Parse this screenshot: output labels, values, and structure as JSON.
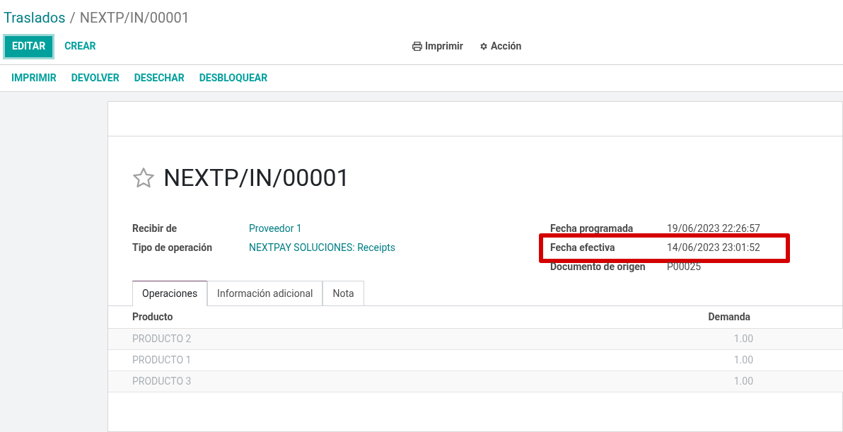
{
  "breadcrumb": {
    "parent": "Traslados",
    "separator": "/",
    "current": "NEXTP/IN/00001"
  },
  "control_buttons": [
    {
      "label": "EDITAR",
      "kind": "primary"
    },
    {
      "label": "CREAR",
      "kind": "link"
    }
  ],
  "toolbar_menus": [
    {
      "label": "Imprimir",
      "kind": "print"
    },
    {
      "label": "Acción",
      "kind": "gear"
    }
  ],
  "action_buttons": [
    "IMPRIMIR",
    "DEVOLVER",
    "DESECHAR",
    "DESBLOQUEAR"
  ],
  "record": {
    "title": "NEXTP/IN/00001",
    "starred": false
  },
  "left_fields": [
    {
      "label": "Recibir de",
      "value": "Proveedor 1",
      "highlighted": false
    },
    {
      "label": "Tipo de operación",
      "value": "NEXTPAY SOLUCIONES: Receipts",
      "highlighted": false
    }
  ],
  "right_fields": [
    {
      "label": "Fecha programada",
      "value": "19/06/2023 22:26:57",
      "highlighted": false
    },
    {
      "label": "Fecha efectiva",
      "value": "14/06/2023 23:01:52",
      "highlighted": true
    },
    {
      "label": "Documento de origen",
      "value": "P00025",
      "highlighted": false
    }
  ],
  "tabs": [
    {
      "label": "Operaciones",
      "selected": true
    },
    {
      "label": "Información adicional",
      "selected": false
    },
    {
      "label": "Nota",
      "selected": false
    }
  ],
  "table": {
    "columns": [
      "Producto",
      "Demanda"
    ],
    "rows": [
      [
        "PRODUCTO 2",
        "1.00"
      ],
      [
        "PRODUCTO 1",
        "1.00"
      ],
      [
        "PRODUCTO 3",
        "1.00"
      ]
    ]
  }
}
